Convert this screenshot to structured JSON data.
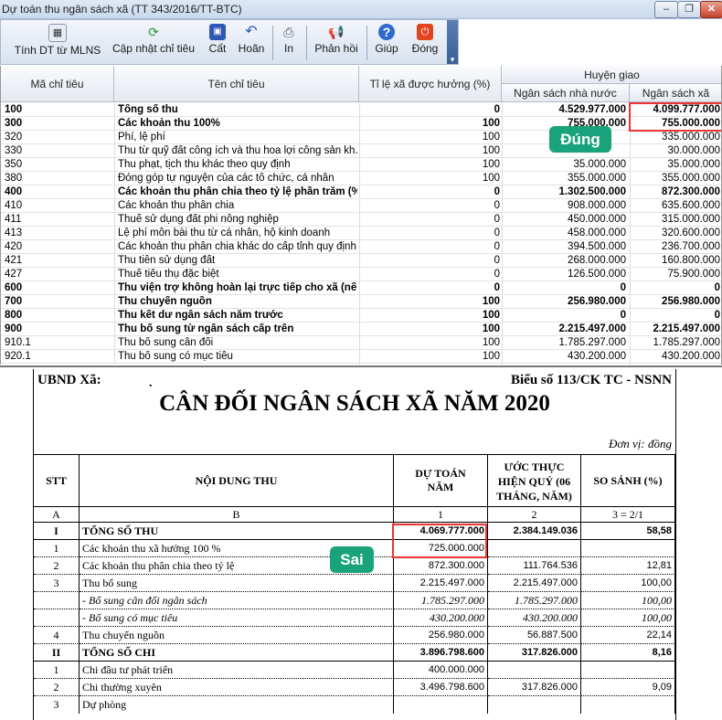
{
  "window": {
    "title": "Dự toán thu ngân sách xã (TT 343/2016/TT-BTC)",
    "minimize": "–",
    "restore": "❐",
    "close": "✕"
  },
  "toolbar": {
    "buttons": [
      {
        "label": "Tính DT từ MLNS",
        "icon": "calculator-icon"
      },
      {
        "label": "Cập nhật chỉ tiêu",
        "icon": "refresh-icon"
      },
      {
        "label": "Cất",
        "icon": "save-icon"
      },
      {
        "label": "Hoãn",
        "icon": "undo-icon"
      },
      {
        "label": "In",
        "icon": "print-icon"
      },
      {
        "label": "Phản hồi",
        "icon": "megaphone-icon"
      },
      {
        "label": "Giúp",
        "icon": "help-icon"
      },
      {
        "label": "Đóng",
        "icon": "close-icon"
      }
    ],
    "overflow": "▾"
  },
  "grid": {
    "headers": {
      "ma": "Mã chỉ tiêu",
      "ten": "Tên chỉ tiêu",
      "tyle": "Tỉ lệ xã được hưởng (%)",
      "group": "Huyện giao",
      "nsnn": "Ngân sách nhà nước",
      "nsx": "Ngân sách xã"
    },
    "rows": [
      {
        "ma": "100",
        "ten": "Tổng số thu",
        "tyle": "0",
        "nsnn": "4.529.977.000",
        "nsx": "4.099.777.000",
        "bold": true
      },
      {
        "ma": "300",
        "ten": "Các khoản thu 100%",
        "tyle": "100",
        "nsnn": "755.000.000",
        "nsx": "755.000.000",
        "bold": true
      },
      {
        "ma": "320",
        "ten": "Phí, lệ phí",
        "tyle": "100",
        "nsnn": "",
        "nsx": "335.000.000",
        "bold": false
      },
      {
        "ma": "330",
        "ten": "Thu từ quỹ đất công ích và thu hoa lợi công sản kh...",
        "tyle": "100",
        "nsnn": "",
        "nsx": "30.000.000",
        "bold": false
      },
      {
        "ma": "350",
        "ten": "Thu phạt, tịch thu khác theo quy định",
        "tyle": "100",
        "nsnn": "35.000.000",
        "nsx": "35.000.000",
        "bold": false
      },
      {
        "ma": "380",
        "ten": "Đóng góp tự nguyện của các tổ chức, cá nhân",
        "tyle": "100",
        "nsnn": "355.000.000",
        "nsx": "355.000.000",
        "bold": false
      },
      {
        "ma": "400",
        "ten": "Các khoản thu phân chia theo tỷ lệ phần trăm (%)",
        "tyle": "0",
        "nsnn": "1.302.500.000",
        "nsx": "872.300.000",
        "bold": true
      },
      {
        "ma": "410",
        "ten": "Các khoản thu phân chia",
        "tyle": "0",
        "nsnn": "908.000.000",
        "nsx": "635.600.000",
        "bold": false
      },
      {
        "ma": "411",
        "ten": "Thuế sử dụng đất phi nông nghiệp",
        "tyle": "0",
        "nsnn": "450.000.000",
        "nsx": "315.000.000",
        "bold": false
      },
      {
        "ma": "413",
        "ten": "Lệ phí môn bài thu từ cá nhân, hộ kinh doanh",
        "tyle": "0",
        "nsnn": "458.000.000",
        "nsx": "320.600.000",
        "bold": false
      },
      {
        "ma": "420",
        "ten": "Các khoản thu phân chia khác do cấp tỉnh quy định",
        "tyle": "0",
        "nsnn": "394.500.000",
        "nsx": "236.700.000",
        "bold": false
      },
      {
        "ma": "421",
        "ten": "Thu tiền sử dụng đất",
        "tyle": "0",
        "nsnn": "268.000.000",
        "nsx": "160.800.000",
        "bold": false
      },
      {
        "ma": "427",
        "ten": "Thuế tiêu thụ đặc biệt",
        "tyle": "0",
        "nsnn": "126.500.000",
        "nsx": "75.900.000",
        "bold": false
      },
      {
        "ma": "600",
        "ten": "Thu viện trợ không hoàn lại trực tiếp cho xã (nếu...",
        "tyle": "0",
        "nsnn": "0",
        "nsx": "0",
        "bold": true
      },
      {
        "ma": "700",
        "ten": "Thu chuyển nguồn",
        "tyle": "100",
        "nsnn": "256.980.000",
        "nsx": "256.980.000",
        "bold": true
      },
      {
        "ma": "800",
        "ten": "Thu kết dư ngân sách năm trước",
        "tyle": "100",
        "nsnn": "0",
        "nsx": "0",
        "bold": true
      },
      {
        "ma": "900",
        "ten": "Thu bổ sung từ ngân sách cấp trên",
        "tyle": "100",
        "nsnn": "2.215.497.000",
        "nsx": "2.215.497.000",
        "bold": true
      },
      {
        "ma": "910.1",
        "ten": "Thu bổ sung cân đối",
        "tyle": "100",
        "nsnn": "1.785.297.000",
        "nsx": "1.785.297.000",
        "bold": false
      },
      {
        "ma": "920.1",
        "ten": "Thu bổ sung có mục tiêu",
        "tyle": "100",
        "nsnn": "430.200.000",
        "nsx": "430.200.000",
        "bold": false
      }
    ]
  },
  "callouts": {
    "correct": "Đúng",
    "wrong": "Sai"
  },
  "report": {
    "ubnd": "UBND Xã:",
    "dot": ".",
    "bieu_so": "Biểu số 113/CK TC - NSNN",
    "title": "CÂN ĐỐI NGÂN SÁCH XÃ NĂM 2020",
    "unit": "Đơn vị: đồng",
    "headers": {
      "stt": "STT",
      "noidung": "NỘI DUNG THU",
      "dutoan_1": "DỰ TOÁN",
      "dutoan_2": "NĂM",
      "uoc_1": "ƯỚC THỰC",
      "uoc_2": "HIỆN QUÝ (06",
      "uoc_3": "THÁNG, NĂM)",
      "sosanh": "SO SÁNH (%)"
    },
    "sub": {
      "a": "A",
      "b": "B",
      "c1": "1",
      "c2": "2",
      "c3": "3 = 2/1"
    },
    "rows": [
      {
        "stt": "I",
        "nd": "TỔNG SỐ THU",
        "dt": "4.069.777.000",
        "uoc": "2.384.149.036",
        "ss": "58,58",
        "style": "bold"
      },
      {
        "stt": "1",
        "nd": "Các khoản thu xã hưởng 100 %",
        "dt": "725.000.000",
        "uoc": "",
        "ss": "",
        "style": "normal"
      },
      {
        "stt": "2",
        "nd": "Các khoản thu phân chia theo tỷ lệ",
        "dt": "872.300.000",
        "uoc": "111.764.536",
        "ss": "12,81",
        "style": "normal"
      },
      {
        "stt": "3",
        "nd": "Thu bổ sung",
        "dt": "2.215.497.000",
        "uoc": "2.215.497.000",
        "ss": "100,00",
        "style": "normal"
      },
      {
        "stt": "",
        "nd": "- Bổ sung cân đối ngân sách",
        "dt": "1.785.297.000",
        "uoc": "1.785.297.000",
        "ss": "100,00",
        "style": "italic"
      },
      {
        "stt": "",
        "nd": "- Bổ sung có mục tiêu",
        "dt": "430.200.000",
        "uoc": "430.200.000",
        "ss": "100,00",
        "style": "italic"
      },
      {
        "stt": "4",
        "nd": "Thu chuyển nguồn",
        "dt": "256.980.000",
        "uoc": "56.887.500",
        "ss": "22,14",
        "style": "normal"
      },
      {
        "stt": "II",
        "nd": "TỔNG SỐ CHI",
        "dt": "3.896.798.600",
        "uoc": "317.826.000",
        "ss": "8,16",
        "style": "bold"
      },
      {
        "stt": "1",
        "nd": "Chi đầu tư phát triển",
        "dt": "400.000.000",
        "uoc": "",
        "ss": "",
        "style": "normal"
      },
      {
        "stt": "2",
        "nd": "Chi thường xuyên",
        "dt": "3.496.798.600",
        "uoc": "317.826.000",
        "ss": "9,09",
        "style": "normal"
      },
      {
        "stt": "3",
        "nd": "Dự phòng",
        "dt": "",
        "uoc": "",
        "ss": "",
        "style": "normal"
      }
    ]
  }
}
